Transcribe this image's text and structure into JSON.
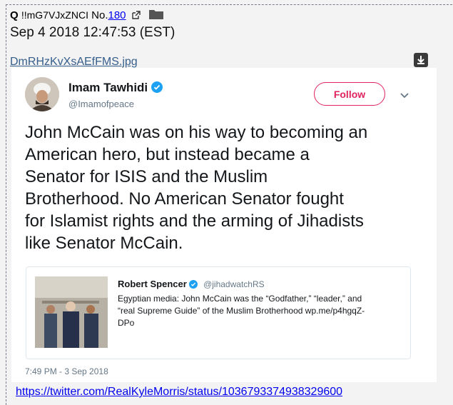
{
  "post": {
    "name": "Q",
    "tripcode": "!!mG7VJxZNCI",
    "number_prefix": "No.",
    "number": "180",
    "date": "Sep 4 2018 12:47:53 (EST)",
    "filename": "DmRHzKvXsAEfFMS.jpg",
    "bottom_link": "https://twitter.com/RealKyleMorris/status/1036793374938329600"
  },
  "tweet": {
    "author": "Imam Tawhidi",
    "handle": "@Imamofpeace",
    "follow_label": "Follow",
    "text": "John McCain was on his way to becoming an\nAmerican hero, but instead became a\nSenator for ISIS and the Muslim\nBrotherhood. No American Senator fought\nfor Islamist rights and the arming of Jihadists\nlike Senator McCain.",
    "timestamp": "7:49 PM - 3 Sep 2018",
    "quoted": {
      "author": "Robert Spencer",
      "handle": "@jihadwatchRS",
      "text": "Egyptian media: John McCain was the “Godfather,” “leader,” and\n“real Supreme Guide” of the Muslim Brotherhood wp.me/p4hgqZ-\nDPo"
    }
  },
  "colors": {
    "link": "#0000ee",
    "file_link": "#355e8c",
    "follow_red": "#e0245e",
    "verified_blue": "#1da1f2"
  },
  "icons": [
    "external-link-icon",
    "folder-icon",
    "download-icon",
    "verified-icon",
    "chevron-down-icon"
  ]
}
